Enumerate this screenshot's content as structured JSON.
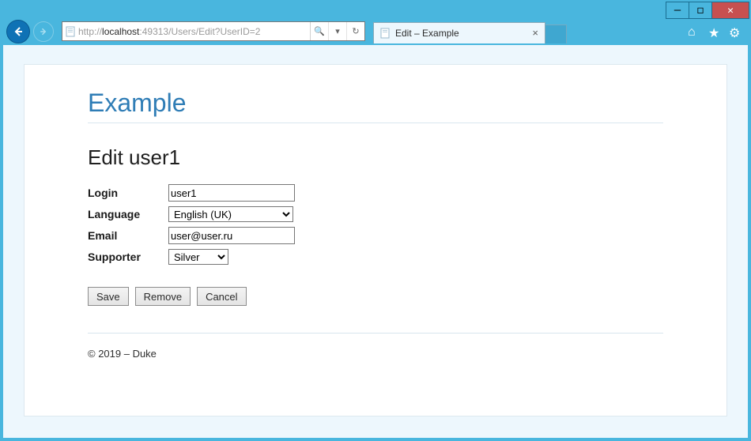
{
  "window": {
    "minimize": "—",
    "maximize": "◻",
    "close": "✕"
  },
  "browser": {
    "url_scheme": "http://",
    "url_host": "localhost",
    "url_port_path": ":49313/Users/Edit?UserID=2",
    "search_glyph": "🔍",
    "dropdown_glyph": "▾",
    "refresh_glyph": "↻",
    "tab_title": "Edit – Example",
    "tab_close": "×",
    "home_glyph": "⌂",
    "star_glyph": "★",
    "gear_glyph": "⚙"
  },
  "page": {
    "brand": "Example",
    "heading": "Edit user1",
    "fields": {
      "login": {
        "label": "Login",
        "value": "user1"
      },
      "language": {
        "label": "Language",
        "value": "English (UK)"
      },
      "email": {
        "label": "Email",
        "value": "user@user.ru"
      },
      "supporter": {
        "label": "Supporter",
        "value": "Silver"
      }
    },
    "buttons": {
      "save": "Save",
      "remove": "Remove",
      "cancel": "Cancel"
    },
    "footer": "© 2019 – Duke"
  }
}
